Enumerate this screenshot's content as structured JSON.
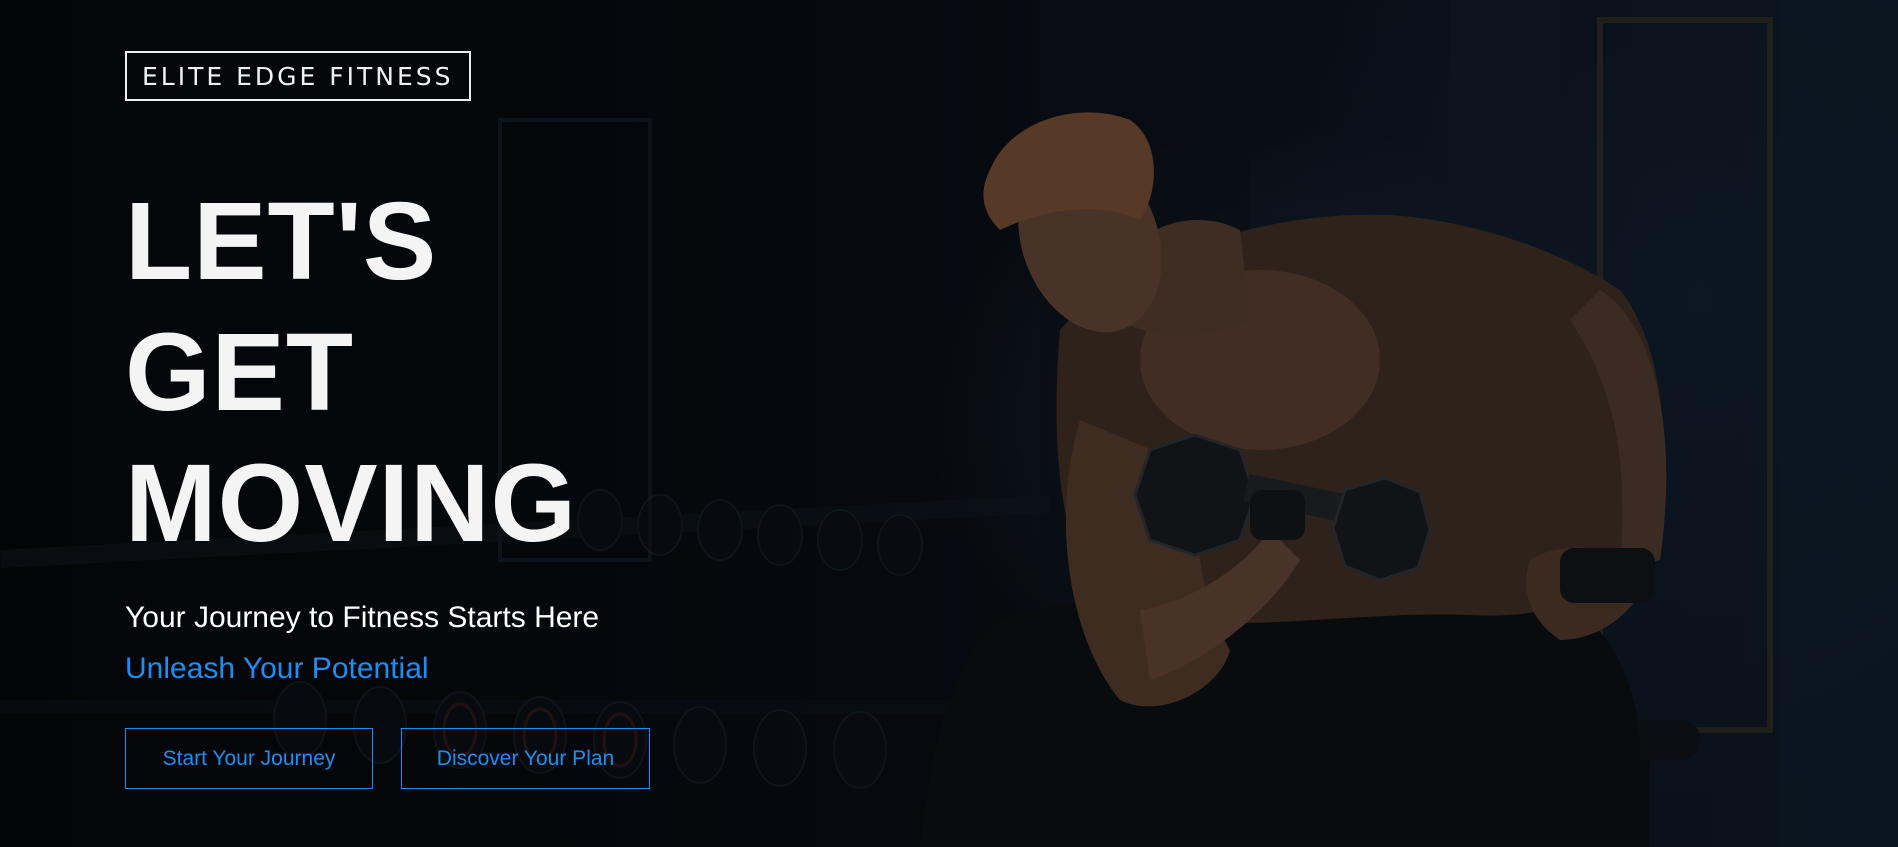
{
  "brand": {
    "logo_text": "ELITE EDGE FITNESS"
  },
  "hero": {
    "headline_lines": [
      "LET'S",
      "GET",
      "MOVING"
    ],
    "subtitle": "Your Journey to Fitness Starts Here",
    "tagline": "Unleash Your Potential",
    "buttons": {
      "start_label": "Start Your Journey",
      "discover_label": "Discover Your Plan"
    }
  },
  "colors": {
    "accent": "#1e8df2",
    "text": "#ffffff",
    "background": "#05080c"
  }
}
